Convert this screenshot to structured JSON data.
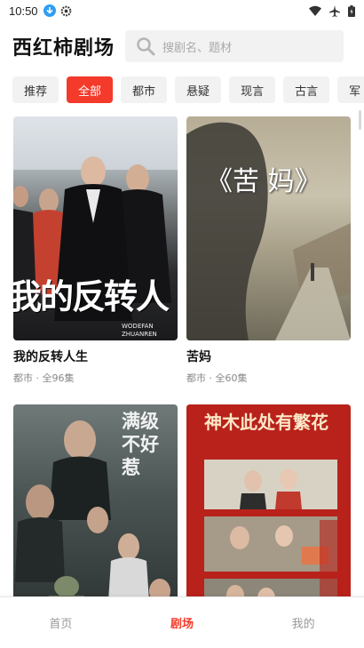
{
  "status_bar": {
    "time": "10:50",
    "icons": [
      "download-icon",
      "gear-icon",
      "wifi-icon",
      "airplane-icon",
      "battery-icon"
    ]
  },
  "header": {
    "title": "西红柿剧场",
    "search_placeholder": "搜剧名、题材"
  },
  "tabs": [
    {
      "label": "推荐",
      "active": false
    },
    {
      "label": "全部",
      "active": true
    },
    {
      "label": "都市",
      "active": false
    },
    {
      "label": "悬疑",
      "active": false
    },
    {
      "label": "现言",
      "active": false
    },
    {
      "label": "古言",
      "active": false
    },
    {
      "label": "军",
      "active": false
    }
  ],
  "dramas": [
    {
      "title": "我的反转人生",
      "genre": "都市",
      "episodes": "全96集",
      "poster_caption": "我的反转人",
      "poster_subcaption": "WODEFAN ZHUANREN"
    },
    {
      "title": "苦妈",
      "genre": "都市",
      "episodes": "全60集",
      "poster_caption": "《苦 妈》"
    },
    {
      "title": "",
      "genre": "",
      "episodes": "",
      "poster_caption": "满级不好惹"
    },
    {
      "title": "",
      "genre": "",
      "episodes": "",
      "poster_caption": "神木此处有繁花"
    }
  ],
  "meta_separator": " · ",
  "bottom_nav": [
    {
      "label": "首页",
      "active": false
    },
    {
      "label": "剧场",
      "active": true
    },
    {
      "label": "我的",
      "active": false
    }
  ],
  "colors": {
    "accent": "#f43a2a",
    "tab_bg": "#f2f2f2",
    "meta_text": "#888888"
  }
}
